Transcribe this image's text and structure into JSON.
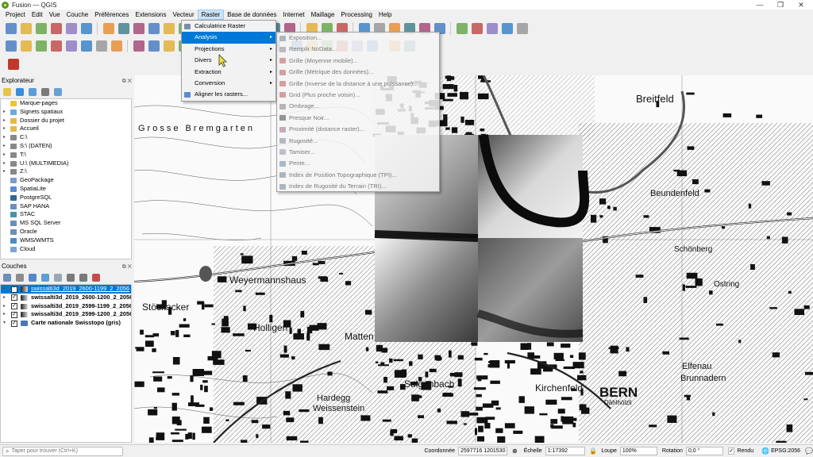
{
  "window": {
    "title": "Fusion — QGIS"
  },
  "menubar": [
    "Project",
    "Edit",
    "Vue",
    "Couche",
    "Préférences",
    "Extensions",
    "Vecteur",
    "Raster",
    "Base de données",
    "Internet",
    "Maillage",
    "Processing",
    "Help"
  ],
  "active_menu": "Raster",
  "raster_menu": {
    "items": [
      {
        "label": "Calculatrice Raster",
        "icon": "calculator-icon",
        "submenu": false
      },
      {
        "label": "Analysis",
        "icon": "",
        "submenu": true,
        "highlighted": true
      },
      {
        "label": "Projections",
        "icon": "",
        "submenu": true
      },
      {
        "label": "Divers",
        "icon": "",
        "submenu": true
      },
      {
        "label": "Extraction",
        "icon": "",
        "submenu": true
      },
      {
        "label": "Conversion",
        "icon": "",
        "submenu": true
      },
      {
        "label": "Aligner les rasters...",
        "icon": "align-icon",
        "submenu": false
      }
    ]
  },
  "analysis_submenu": {
    "items": [
      {
        "label": "Exposition...",
        "icon": "aspect-icon"
      },
      {
        "label": "Remplir NoData...",
        "icon": "fill-nodata-icon"
      },
      {
        "label": "Grille (Moyenne mobile)...",
        "icon": "grid-icon"
      },
      {
        "label": "Grille (Métrique des données)...",
        "icon": "grid-icon"
      },
      {
        "label": "Grille (Inverse de la distance à une puissance)...",
        "icon": "grid-icon"
      },
      {
        "label": "Grid (Plus proche voisin)...",
        "icon": "grid-icon"
      },
      {
        "label": "Ombrage...",
        "icon": "hillshade-icon"
      },
      {
        "label": "Presque Noir...",
        "icon": "nearblack-icon"
      },
      {
        "label": "Proximité (distance raster)...",
        "icon": "proximity-icon"
      },
      {
        "label": "Rugosité...",
        "icon": "roughness-icon"
      },
      {
        "label": "Tamiser...",
        "icon": "sieve-icon"
      },
      {
        "label": "Pente...",
        "icon": "slope-icon"
      },
      {
        "label": "Index de Position Topographique (TPI)...",
        "icon": "tpi-icon"
      },
      {
        "label": "Index de Rugosité du Terrain (TRI)...",
        "icon": "tri-icon"
      }
    ]
  },
  "browser_panel": {
    "title": "Explorateur",
    "items": [
      {
        "label": "Marque-pages",
        "icon": "star-icon",
        "expand": false
      },
      {
        "label": "Signets spatiaux",
        "icon": "bookmark-icon",
        "expand": true
      },
      {
        "label": "Dossier du projet",
        "icon": "folder-icon",
        "expand": true
      },
      {
        "label": "Accueil",
        "icon": "folder-icon",
        "expand": true
      },
      {
        "label": "C:\\",
        "icon": "drive-icon",
        "expand": true
      },
      {
        "label": "S:\\ (DATEN)",
        "icon": "drive-icon",
        "expand": true
      },
      {
        "label": "T:\\",
        "icon": "drive-icon",
        "expand": true
      },
      {
        "label": "U:\\ (MULTIMEDIA)",
        "icon": "drive-icon",
        "expand": true
      },
      {
        "label": "Z:\\",
        "icon": "drive-icon",
        "expand": true
      },
      {
        "label": "GeoPackage",
        "icon": "geopackage-icon",
        "expand": false
      },
      {
        "label": "SpatiaLite",
        "icon": "spatialite-icon",
        "expand": false
      },
      {
        "label": "PostgreSQL",
        "icon": "postgresql-icon",
        "expand": false
      },
      {
        "label": "SAP HANA",
        "icon": "database-icon",
        "expand": false
      },
      {
        "label": "STAC",
        "icon": "stac-icon",
        "expand": false
      },
      {
        "label": "MS SQL Server",
        "icon": "database-icon",
        "expand": false
      },
      {
        "label": "Oracle",
        "icon": "database-icon",
        "expand": false
      },
      {
        "label": "WMS/WMTS",
        "icon": "globe-icon",
        "expand": false
      },
      {
        "label": "Cloud",
        "icon": "cloud-icon",
        "expand": false
      }
    ]
  },
  "layers_panel": {
    "title": "Couches",
    "layers": [
      {
        "label": "swissalti3d_2019_2600-1199_2_2056",
        "selected": true,
        "checked": true
      },
      {
        "label": "swissalti3d_2019_2600-1200_2_2056",
        "selected": false,
        "checked": true
      },
      {
        "label": "swissalti3d_2019_2599-1199_2_2056",
        "selected": false,
        "checked": true
      },
      {
        "label": "swissalti3d_2019_2599-1200_2_2056",
        "selected": false,
        "checked": true
      },
      {
        "label": "Carte nationale Swisstopo (gris)",
        "selected": false,
        "checked": true,
        "bold": true,
        "expanded": true
      }
    ]
  },
  "map_labels": {
    "bern": "BERN",
    "weyermannshaus": "Weyermannshaus",
    "hardegg": "Hardegg",
    "weissenstein": "Weissenstein",
    "sulgenbach": "Sulgenbach",
    "kirchenfeld": "Kirchenfeld",
    "breitfeld": "Breitfeld",
    "beundenfeld": "Beundenfeld",
    "elfenau": "Elfenau",
    "hollingen": "Holligen",
    "stockacker": "Stöckacker",
    "mattenhof": "Matten",
    "bremgarten": "Grosse Bremgarten",
    "ostring": "Ostring",
    "schonberg": "Schönberg",
    "dahlholzli": "Dählhölzli",
    "brunnadern": "Brunnadern"
  },
  "statusbar": {
    "search_placeholder": "Taper pour trouver (Ctrl+K)",
    "coord_label": "Coordonnée",
    "coord_value": "2597716 1201530",
    "scale_label": "Échelle",
    "scale_value": "1:17392",
    "magnifier_label": "Loupe",
    "magnifier_value": "100%",
    "rotation_label": "Rotation",
    "rotation_value": "0,0 °",
    "render_label": "Rendu",
    "crs": "EPSG:2056"
  }
}
